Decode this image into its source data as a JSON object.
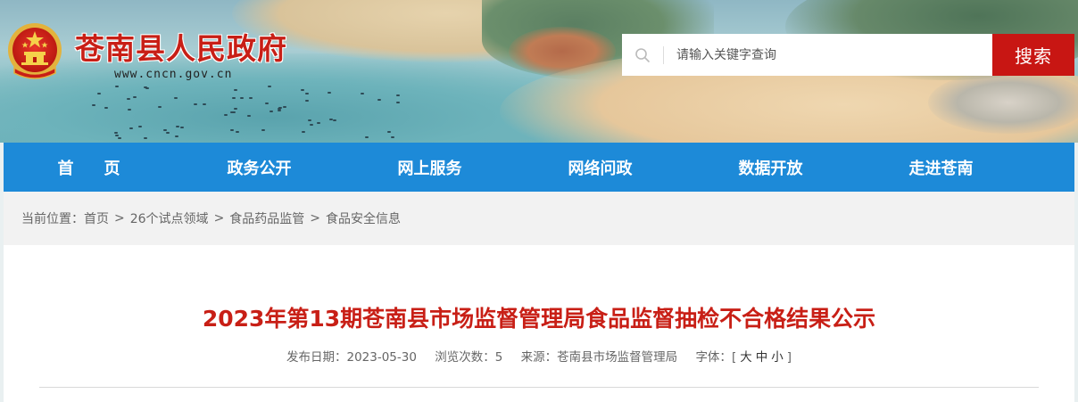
{
  "header": {
    "site_title": "苍南县人民政府",
    "site_url": "www.cncn.gov.cn",
    "emblem_icon": "national-emblem-icon"
  },
  "search": {
    "placeholder": "请输入关键字查询",
    "button_label": "搜索",
    "icon": "search-icon"
  },
  "nav": {
    "items": [
      {
        "label": "首页"
      },
      {
        "label": "政务公开"
      },
      {
        "label": "网上服务"
      },
      {
        "label": "网络问政"
      },
      {
        "label": "数据开放"
      },
      {
        "label": "走进苍南"
      }
    ]
  },
  "breadcrumb": {
    "prefix": "当前位置：",
    "items": [
      "首页",
      "26个试点领域",
      "食品药品监管",
      "食品安全信息"
    ],
    "separator": ">"
  },
  "article": {
    "title": "2023年第13期苍南县市场监督管理局食品监督抽检不合格结果公示",
    "publish_label": "发布日期：",
    "publish_date": "2023-05-30",
    "views_label": "浏览次数：",
    "views": "5",
    "source_label": "来源：",
    "source": "苍南县市场监督管理局",
    "font_label": "字体：",
    "font_open": "[",
    "font_large": "大",
    "font_medium": "中",
    "font_small": "小",
    "font_close": "]"
  },
  "colors": {
    "brand_red": "#c81f16",
    "nav_blue": "#1d8ad8",
    "search_red": "#c81613"
  }
}
